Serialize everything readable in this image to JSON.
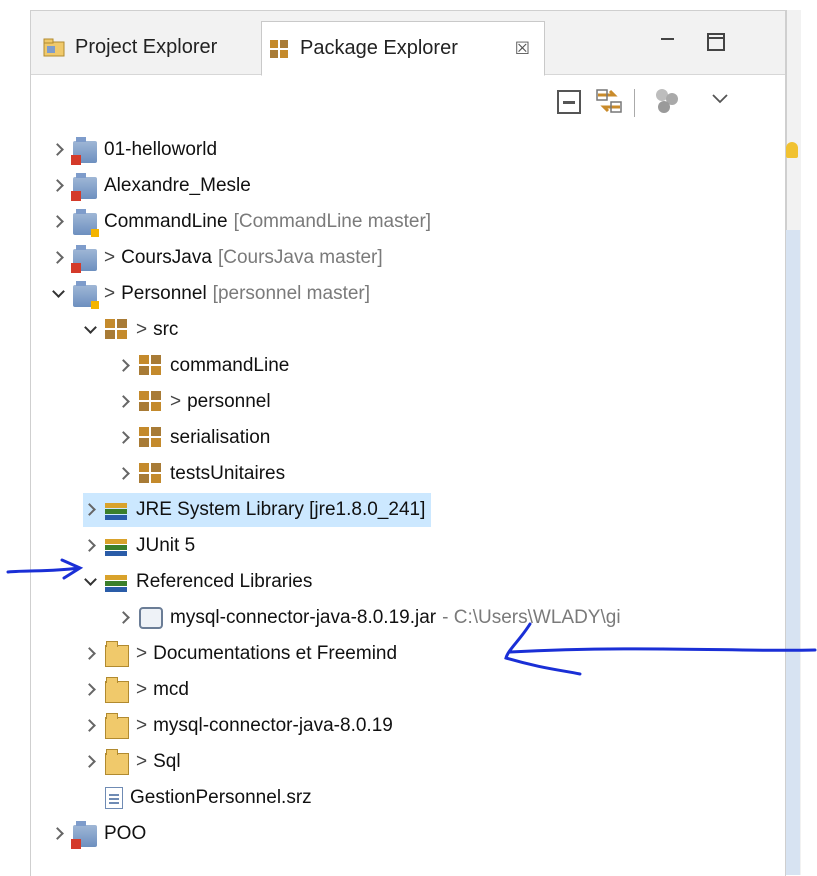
{
  "tabs": {
    "project_explorer": "Project Explorer",
    "package_explorer": "Package Explorer",
    "close_glyph": "☒"
  },
  "tree": {
    "rows": [
      {
        "label": "01-helloworld",
        "prefix": "",
        "decor": ""
      },
      {
        "label": "Alexandre_Mesle",
        "prefix": "",
        "decor": ""
      },
      {
        "label": "CommandLine",
        "prefix": "",
        "decor": "[CommandLine master]"
      },
      {
        "label": "CoursJava",
        "prefix": ">",
        "decor": "[CoursJava master]"
      },
      {
        "label": "Personnel",
        "prefix": ">",
        "decor": "[personnel master]"
      },
      {
        "label": "src",
        "prefix": ">",
        "decor": ""
      },
      {
        "label": "commandLine",
        "prefix": "",
        "decor": ""
      },
      {
        "label": "personnel",
        "prefix": ">",
        "decor": ""
      },
      {
        "label": "serialisation",
        "prefix": "",
        "decor": ""
      },
      {
        "label": "testsUnitaires",
        "prefix": "",
        "decor": ""
      },
      {
        "label": "JRE System Library [jre1.8.0_241]",
        "prefix": "",
        "decor": ""
      },
      {
        "label": "JUnit 5",
        "prefix": "",
        "decor": ""
      },
      {
        "label": "Referenced Libraries",
        "prefix": "",
        "decor": ""
      },
      {
        "label": "mysql-connector-java-8.0.19.jar",
        "prefix": "",
        "decor": "- C:\\Users\\WLADY\\gi"
      },
      {
        "label": "Documentations  et Freemind",
        "prefix": ">",
        "decor": ""
      },
      {
        "label": "mcd",
        "prefix": ">",
        "decor": ""
      },
      {
        "label": "mysql-connector-java-8.0.19",
        "prefix": ">",
        "decor": ""
      },
      {
        "label": "Sql",
        "prefix": ">",
        "decor": ""
      },
      {
        "label": "GestionPersonnel.srz",
        "prefix": "",
        "decor": ""
      },
      {
        "label": "POO",
        "prefix": "",
        "decor": ""
      }
    ]
  },
  "colors": {
    "selection": "#cce8ff",
    "annotation_ink": "#1a2fd6"
  }
}
